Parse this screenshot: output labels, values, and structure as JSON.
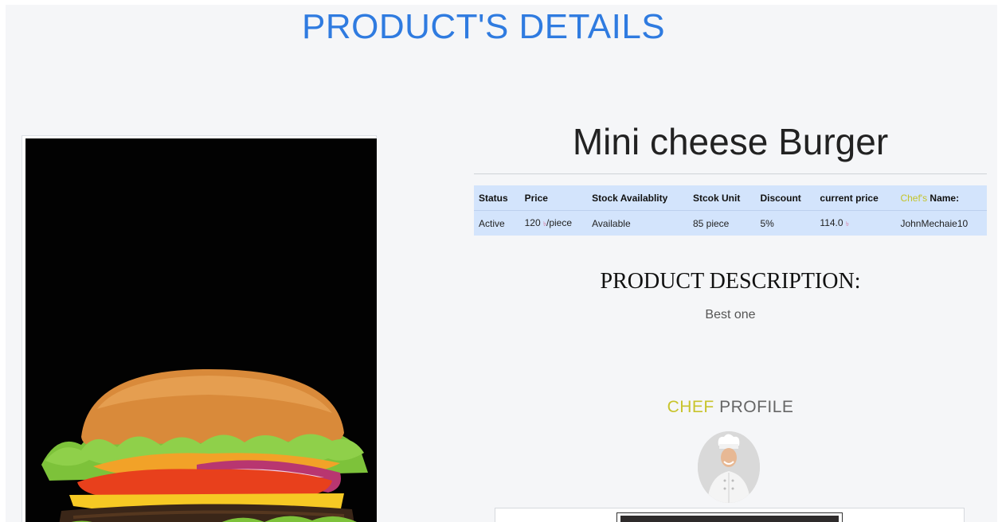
{
  "page": {
    "title": "PRODUCT'S DETAILS"
  },
  "product": {
    "name": "Mini cheese Burger",
    "image_alt": "burger-photo"
  },
  "table": {
    "headers": {
      "status": "Status",
      "price": "Price",
      "stock_availability": "Stock Availablity",
      "stock_unit": "Stcok Unit",
      "discount": "Discount",
      "current_price": "current price",
      "chef_name_prefix": "Chef's",
      "chef_name_suffix": "Name:"
    },
    "row": {
      "status": "Active",
      "price": "120",
      "price_currency": "৳",
      "price_unit": "/piece",
      "stock_availability": "Available",
      "stock_unit": "85 piece",
      "discount": "5%",
      "current_price": "114.0",
      "current_price_currency": "৳",
      "chef_name": "JohnMechaie10"
    }
  },
  "description": {
    "title": "PRODUCT DESCRIPTION:",
    "text": "Best one"
  },
  "chef_profile": {
    "title_accent": "CHEF",
    "title_rest": "PROFILE"
  },
  "colors": {
    "title_blue": "#2f7be0",
    "table_bg": "#d3e4fc",
    "price_red": "#c2185b",
    "chef_accent": "#c8c42c",
    "page_bg": "#f5f6f8"
  }
}
